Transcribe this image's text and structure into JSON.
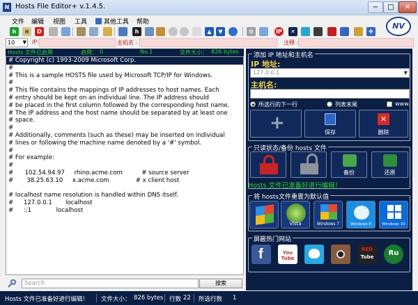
{
  "window": {
    "title": "Hosts File Editor+ v.1.4.5.",
    "app_icon_letter": "N",
    "minimize": "−",
    "maximize": "□",
    "close": "✕"
  },
  "menu": [
    "文件",
    "编辑",
    "视图",
    "工具",
    "其他工具",
    "帮助"
  ],
  "filter": {
    "font_size": "10",
    "ip_label": "IP:",
    "hostname_label": "主机名 :",
    "note_label": "注释 :"
  },
  "editor_header": {
    "status": "Hosts 文件已启用",
    "enabled_label": "启用：",
    "enabled_value": "0",
    "line_label": "No.1",
    "size_label": "文件大小：",
    "size_value": "826 bytes"
  },
  "editor_lines": [
    "# Copyright (c) 1993-2009 Microsoft Corp.",
    "#",
    "# This is a sample HOSTS file used by Microsoft TCP/IP for Windows.",
    "#",
    "# This file contains the mappings of IP addresses to host names. Each",
    "# entry should be kept on an individual line. The IP address should",
    "# be placed in the first column followed by the corresponding host name.",
    "# The IP address and the host name should be separated by at least one",
    "# space.",
    "#",
    "# Additionally, comments (such as these) may be inserted on individual",
    "# lines or following the machine name denoted by a '#' symbol.",
    "#",
    "# For example:",
    "#",
    "#      102.54.94.97     rhino.acme.com          # source server",
    "#       38.25.63.10     x.acme.com              # x client host",
    "",
    "# localhost name resolution is handled within DNS itself.",
    "#\t127.0.0.1       localhost",
    "#\t::1             localhost"
  ],
  "panel": {
    "add_group_title": "添加 IP 地址和主机名",
    "ip_label": "IP 地址:",
    "ip_value": "127.0.0.1",
    "hostname_label": "主机名:",
    "radio_selected_next": "所选行的下一行",
    "radio_end": "列表末尾",
    "radio_www": "www.",
    "save_label": "保存",
    "delete_label": "删除",
    "readonly_group_title": "只读状态/备份 hosts 文件",
    "backup_label": "备份",
    "restore_label": "还原",
    "ready_text": "Hosts 文件已准备好进行编辑！",
    "reset_group_title": "将 hosts文件重置为默认值",
    "win_xp": "WinXP",
    "vista": "Vista",
    "win7": "Windows 7",
    "win8": "Windows 8",
    "win10": "Windows 10",
    "block_group_title": "屏蔽热门网站",
    "youtube": "You Tube",
    "redtube_top": "RED",
    "redtube_bottom": "Tube",
    "ru": "Ru"
  },
  "search": {
    "placeholder": "Search",
    "button": "搜索"
  },
  "status": {
    "message": "Hosts 文件已准备好进行编辑！",
    "size_label": "文件大小：",
    "size_value": "826 bytes",
    "lines_label": "行数",
    "lines_value": "22",
    "selected_label": "所选行数",
    "selected_value": "1"
  },
  "colors": {
    "panel_bg": "#0b1f45",
    "accent_yellow": "#f1d14a",
    "ready_green": "#2cd52c",
    "filter_field_bg": "#f7dada"
  }
}
